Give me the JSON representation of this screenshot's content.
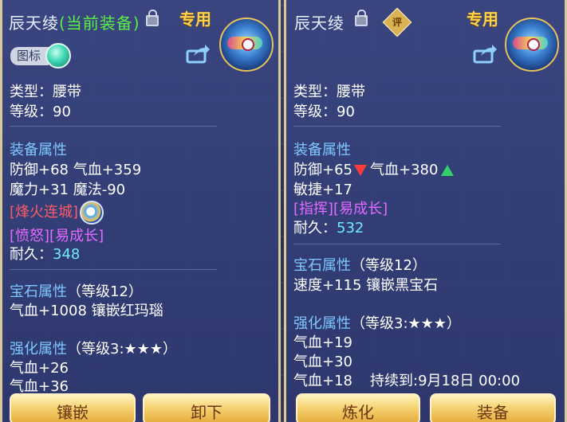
{
  "left": {
    "title": "辰天绫",
    "title_tag": "(当前装备)",
    "exclusive_label": "专用",
    "icon_toggle_label": "图标",
    "type_line": "类型：腰带",
    "level_line": "等级：90",
    "equip_attr_header": "装备属性",
    "attr_line1": "防御+68 气血+359",
    "attr_line2": "魔力+31 魔法-90",
    "special_skill": "[烽火连城]",
    "tags": "[愤怒][易成长]",
    "durability_label": "耐久：",
    "durability_value": "348",
    "gem_header": "宝石属性",
    "gem_level": "（等级12）",
    "gem_line": "气血+1008 镶嵌红玛瑙",
    "enhance_header": "强化属性",
    "enhance_level": "（等级3:★★★）",
    "enhance_line1": "气血+26",
    "enhance_line2": "气血+36",
    "btn_inlay": "镶嵌",
    "btn_remove": "卸下"
  },
  "right": {
    "title": "辰天绫",
    "eval_badge": "评",
    "exclusive_label": "专用",
    "type_line": "类型：腰带",
    "level_line": "等级：90",
    "equip_attr_header": "装备属性",
    "defense": "防御+65",
    "hp": "气血+380",
    "attr_line2": "敏捷+17",
    "tags": "[指挥][易成长]",
    "durability_label": "耐久：",
    "durability_value": "532",
    "gem_header": "宝石属性",
    "gem_level": "（等级12）",
    "gem_line": "速度+115 镶嵌黑宝石",
    "enhance_header": "强化属性",
    "enhance_level": "（等级3:★★★）",
    "enhance_line1": "气血+19",
    "enhance_line2": "气血+30",
    "enhance_line3": "气血+18",
    "duration": "持续到:9月18日 00:00",
    "btn_refine": "炼化",
    "btn_equip": "装备"
  },
  "colors": {
    "panel_border": "#d9c89a",
    "section_header": "#7fc8ff",
    "current_equip": "#59ef45",
    "special_skill": "#ff5b6a",
    "tags": "#e56aff",
    "durability_value": "#6fe9ff",
    "button_gold": "#f5d272"
  },
  "icons": [
    "lock-icon",
    "share-icon",
    "equipment-belt-icon",
    "toggle-knob-icon",
    "skill-icon",
    "arrow-down-icon",
    "arrow-up-icon",
    "evaluate-badge-icon"
  ]
}
